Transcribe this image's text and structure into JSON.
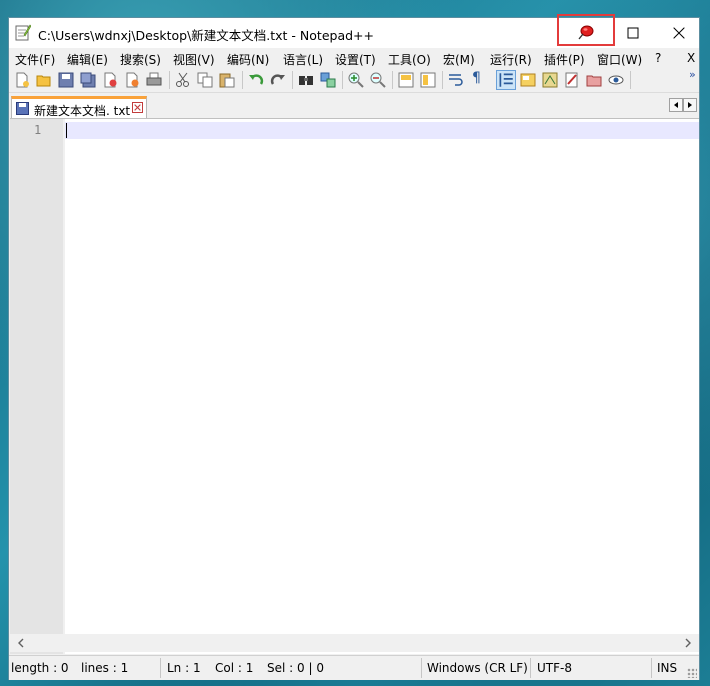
{
  "window": {
    "title": "C:\\Users\\wdnxj\\Desktop\\新建文本文档.txt - Notepad++"
  },
  "menu": [
    "文件(F)",
    "编辑(E)",
    "搜索(S)",
    "视图(V)",
    "编码(N)",
    "语言(L)",
    "设置(T)",
    "工具(O)",
    "宏(M)",
    "运行(R)",
    "插件(P)",
    "窗口(W)",
    "?",
    "X"
  ],
  "tab": {
    "label": "新建文本文档. txt"
  },
  "editor": {
    "line_numbers": [
      "1"
    ]
  },
  "status": {
    "length": "length : 0",
    "lines": "lines : 1",
    "ln": "Ln : 1",
    "col": "Col : 1",
    "sel": "Sel : 0 | 0",
    "eol": "Windows (CR LF)",
    "encoding": "UTF-8",
    "mode": "INS"
  },
  "toolbar_more": "»",
  "colors": {
    "accent_tab": "#f9a23a",
    "current_line": "#e8e8ff",
    "highlight_box": "#e33b3b"
  }
}
